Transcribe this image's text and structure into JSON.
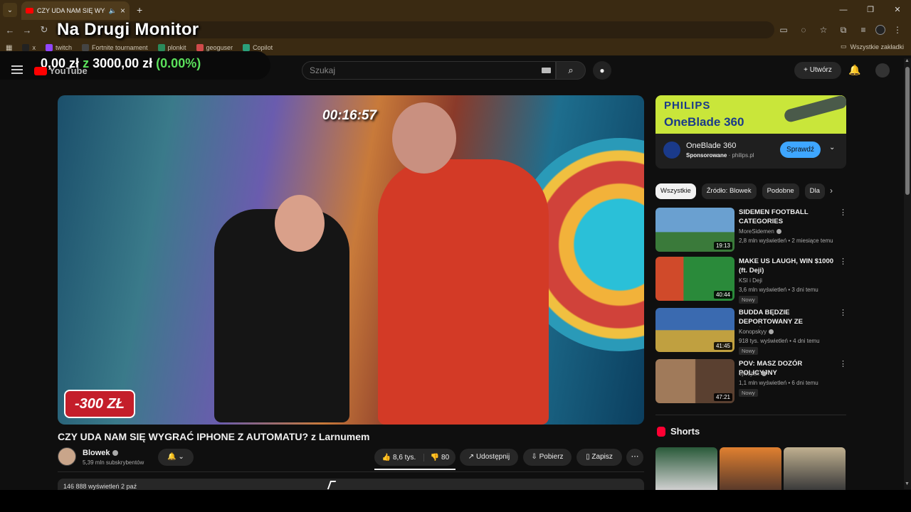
{
  "browser": {
    "tab_title": "CZY UDA NAM SIĘ WYGRAĆ",
    "window_controls": [
      "—",
      "❐",
      "✕"
    ],
    "bookmarks": [
      {
        "label": "x",
        "color": "#222222"
      },
      {
        "label": "twitch",
        "color": "#9146ff"
      },
      {
        "label": "Fortnite tournament",
        "color": "#444444"
      },
      {
        "label": "plonkit",
        "color": "#2a8a5a"
      },
      {
        "label": "geoguser",
        "color": "#d04a4a"
      },
      {
        "label": "Copilot",
        "color": "#2aa07a"
      }
    ],
    "all_bookmarks": "Wszystkie zakładki"
  },
  "overlay": {
    "title": "Na Drugi Monitor",
    "money_left": "0,00 zł",
    "money_z": "z",
    "money_right": "3000,00 zł",
    "money_percent": "(0.00%)"
  },
  "youtube": {
    "logo": "YouTube",
    "search_placeholder": "Szukaj",
    "create_label": "Utwórz"
  },
  "player": {
    "timer": "00:16:57",
    "badge": "-300 ZŁ"
  },
  "video": {
    "title": "CZY UDA NAM SIĘ WYGRAĆ IPHONE Z AUTOMATU? z Larnumem",
    "channel": "Blowek",
    "subscribers": "5,39 mln subskrybentów",
    "likes": "8,6 tys.",
    "dislikes": "80",
    "share": "Udostępnij",
    "download": "Pobierz",
    "save": "Zapisz",
    "description_peek": "146 888 wyświetleń  2 paź"
  },
  "ad": {
    "brand": "PHILIPS",
    "product": "OneBlade 360",
    "name": "OneBlade 360",
    "sponsored": "Sponsorowane",
    "domain": "philips.pl",
    "cta": "Sprawdź"
  },
  "chips": [
    "Wszystkie",
    "Źródło: Blowek",
    "Podobne",
    "Dla"
  ],
  "recommendations": [
    {
      "title": "SIDEMEN FOOTBALL CATEGORIES",
      "channel": "MoreSidemen",
      "verified": true,
      "meta": "2,8 mln wyświetleń • 2 miesiące temu",
      "duration": "19:13",
      "badge": "",
      "colors": [
        "#6aa0d0",
        "#3a7a3a"
      ]
    },
    {
      "title": "MAKE US LAUGH, WIN $1000 (ft. Deji)",
      "channel": "KSI i Deji",
      "verified": false,
      "meta": "3,6 mln wyświetleń • 3 dni temu",
      "duration": "40:44",
      "badge": "Nowy",
      "colors": [
        "#d04a2a",
        "#2a8a3a"
      ]
    },
    {
      "title": "BUDDA BĘDZIE DEPORTOWANY ZE STANÓW? (ELON MUSK vs ...",
      "channel": "Konopskyy",
      "verified": true,
      "meta": "918 tys. wyświetleń • 4 dni temu",
      "duration": "41:45",
      "badge": "Nowy",
      "colors": [
        "#3a6ab0",
        "#c0a040"
      ]
    },
    {
      "title": "POV: MASZ DOZÓR POLICYJNY",
      "channel": "ojwojtek",
      "verified": true,
      "meta": "1,1 mln wyświetleń • 6 dni temu",
      "duration": "47:21",
      "badge": "Nowy",
      "colors": [
        "#a07a5a",
        "#5a4030"
      ]
    }
  ],
  "shorts": {
    "label": "Shorts",
    "thumbs": [
      {
        "colors": [
          "#2a5a3a",
          "#d0d0d0"
        ]
      },
      {
        "colors": [
          "#e08030",
          "#5a3a2a"
        ]
      },
      {
        "colors": [
          "#c0b090",
          "#3a3a3a"
        ]
      }
    ]
  },
  "colors": {
    "background": "#0f0f0f",
    "accent_red": "#ff0000",
    "subscribe_blue": "#3ea6ff"
  }
}
